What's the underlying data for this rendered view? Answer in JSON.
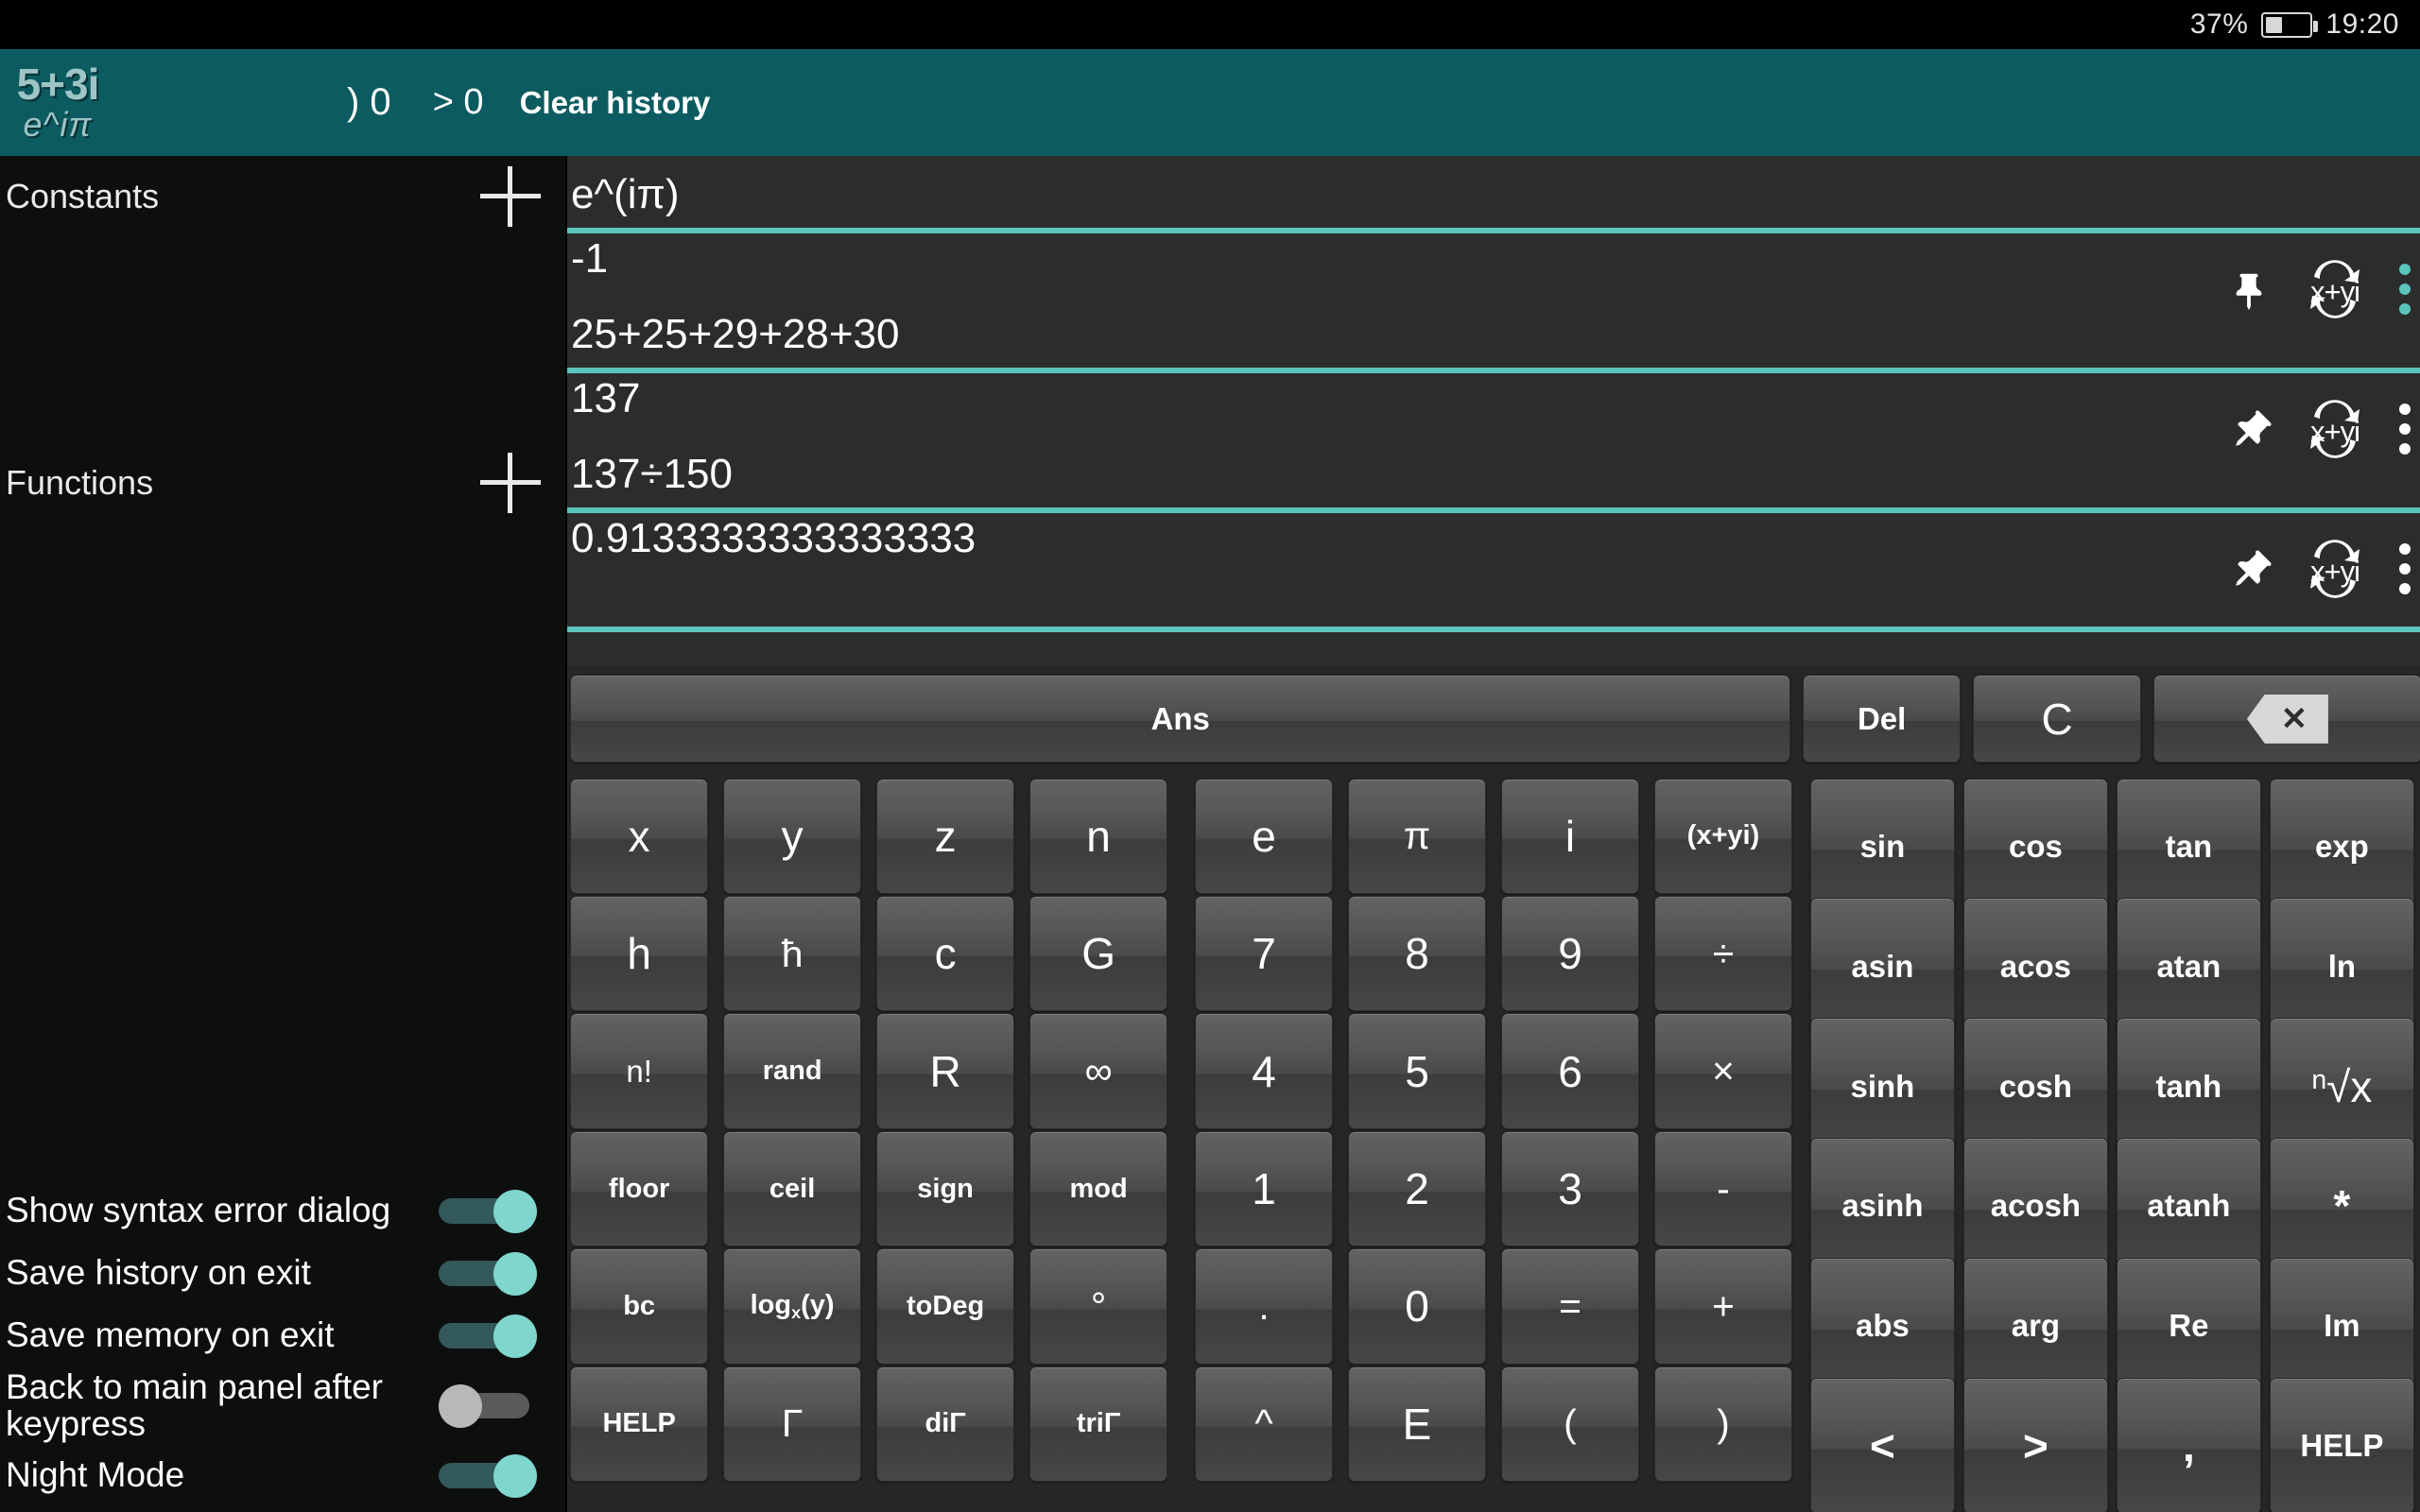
{
  "status_bar": {
    "battery_percent": "37%",
    "battery_level": 37,
    "clock": "19:20"
  },
  "app_bar": {
    "logo_top": "5+3i",
    "logo_bottom": "e^iπ",
    "paren_count": ") 0",
    "greater_count": "> 0",
    "clear_history_label": "Clear history",
    "background_color": "#0b5b60"
  },
  "sidebar": {
    "constants_label": "Constants",
    "constants_add_label": "+",
    "functions_label": "Functions",
    "functions_add_label": "+",
    "settings": [
      {
        "label": "Show syntax error dialog",
        "state": "on"
      },
      {
        "label": "Save history on exit",
        "state": "on"
      },
      {
        "label": "Save memory on exit",
        "state": "on"
      },
      {
        "label": "Back to main panel after keypress",
        "state": "off"
      },
      {
        "label": "Night Mode",
        "state": "on"
      }
    ],
    "toggle_on_color": "#7fd6cd",
    "toggle_off_color": "#b8b8b8"
  },
  "history": {
    "separator_color": "#5bc4bd",
    "entries": [
      {
        "expression": "e^(iπ)",
        "result": "-1",
        "pinned": true,
        "convert_label": "x+yi",
        "menu_color": "#5bc4bd"
      },
      {
        "expression": "25+25+29+28+30",
        "result": "137",
        "pinned": false,
        "convert_label": "x+yi",
        "menu_color": "#ffffff"
      },
      {
        "expression": "137÷150",
        "result": "0.9133333333333333",
        "pinned": false,
        "convert_label": "x+yi",
        "menu_color": "#ffffff"
      }
    ],
    "input_value": ""
  },
  "keypad": {
    "top_row": [
      {
        "label": "Ans",
        "name": "ans"
      },
      {
        "label": "Del",
        "name": "del"
      },
      {
        "label": "C",
        "name": "clear"
      },
      {
        "label": "⌫",
        "name": "backspace"
      }
    ],
    "left_rows": [
      [
        "x",
        "y",
        "z",
        "n",
        "e",
        "π",
        "i",
        "(x+yi)"
      ],
      [
        "h",
        "ħ",
        "c",
        "G",
        "7",
        "8",
        "9",
        "÷"
      ],
      [
        "n!",
        "rand",
        "R",
        "∞",
        "4",
        "5",
        "6",
        "×"
      ],
      [
        "floor",
        "ceil",
        "sign",
        "mod",
        "1",
        "2",
        "3",
        "-"
      ],
      [
        "bc",
        "logx(y)",
        "toDeg",
        "°",
        ".",
        "0",
        "=",
        "+"
      ],
      [
        "HELP",
        "Γ",
        "diΓ",
        "triΓ",
        "^",
        "E",
        "(",
        ")"
      ]
    ],
    "right_rows": [
      [
        "sin",
        "cos",
        "tan",
        "exp"
      ],
      [
        "asin",
        "acos",
        "atan",
        "ln"
      ],
      [
        "sinh",
        "cosh",
        "tanh",
        "ⁿ√x"
      ],
      [
        "asinh",
        "acosh",
        "atanh",
        "*"
      ],
      [
        "abs",
        "arg",
        "Re",
        "Im"
      ],
      [
        "<",
        ">",
        ",",
        "HELP"
      ]
    ]
  }
}
